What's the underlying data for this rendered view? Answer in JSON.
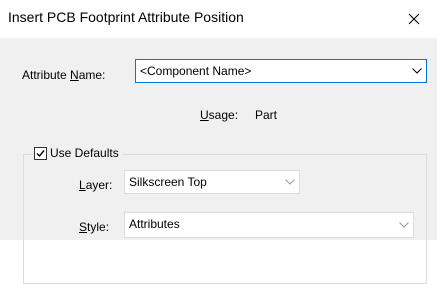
{
  "dialog": {
    "title": "Insert PCB Footprint Attribute Position",
    "close_icon": "close-icon"
  },
  "attribute_name": {
    "label_pre": "Attribute ",
    "label_mnemonic": "N",
    "label_post": "ame:",
    "value": "<Component Name>"
  },
  "usage": {
    "label_mnemonic": "U",
    "label_post": "sage:",
    "value": "Part"
  },
  "use_defaults": {
    "label": "Use Defaults",
    "checked": true
  },
  "layer": {
    "label_mnemonic": "L",
    "label_post": "ayer:",
    "value": "Silkscreen Top"
  },
  "style": {
    "label_mnemonic": "S",
    "label_post": "tyle:",
    "value": "Attributes"
  },
  "colors": {
    "focus_border": "#0078d7",
    "client_bg": "#f0f0f0"
  }
}
